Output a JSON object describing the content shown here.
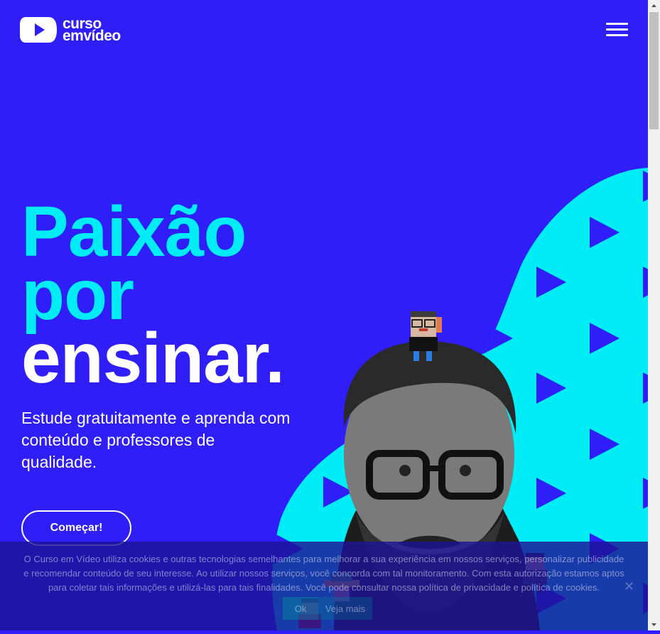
{
  "brand": {
    "logo_line1": "curso",
    "logo_line2": "emvídeo",
    "logo_icon": "play-icon",
    "colors": {
      "background": "#2f1ef7",
      "accent": "#00ecf7",
      "text": "#ffffff"
    }
  },
  "nav": {
    "menu_icon": "hamburger-menu-icon"
  },
  "hero": {
    "title_line1": "Paixão",
    "title_line2": "por",
    "title_line3": "ensinar.",
    "subtitle": "Estude gratuitamente e aprenda com conteúdo e professores de qualidade.",
    "cta_label": "Começar!"
  },
  "cookie_banner": {
    "text": "O Curso em Vídeo utiliza cookies e outras tecnologias semelhantes para melhorar a sua experiência em nossos serviços, personalizar publicidade e recomendar conteúdo de seu interesse. Ao utilizar nossos serviços, você concorda com tal monitoramento. Com esta autorização estamos aptos para coletar tais informações e utilizá-las para tais finalidades. Você pode consultar nossa política de privacidade e política de cookies.",
    "ok_label": "Ok",
    "more_label": "Veja mais",
    "close_icon": "close-icon"
  }
}
